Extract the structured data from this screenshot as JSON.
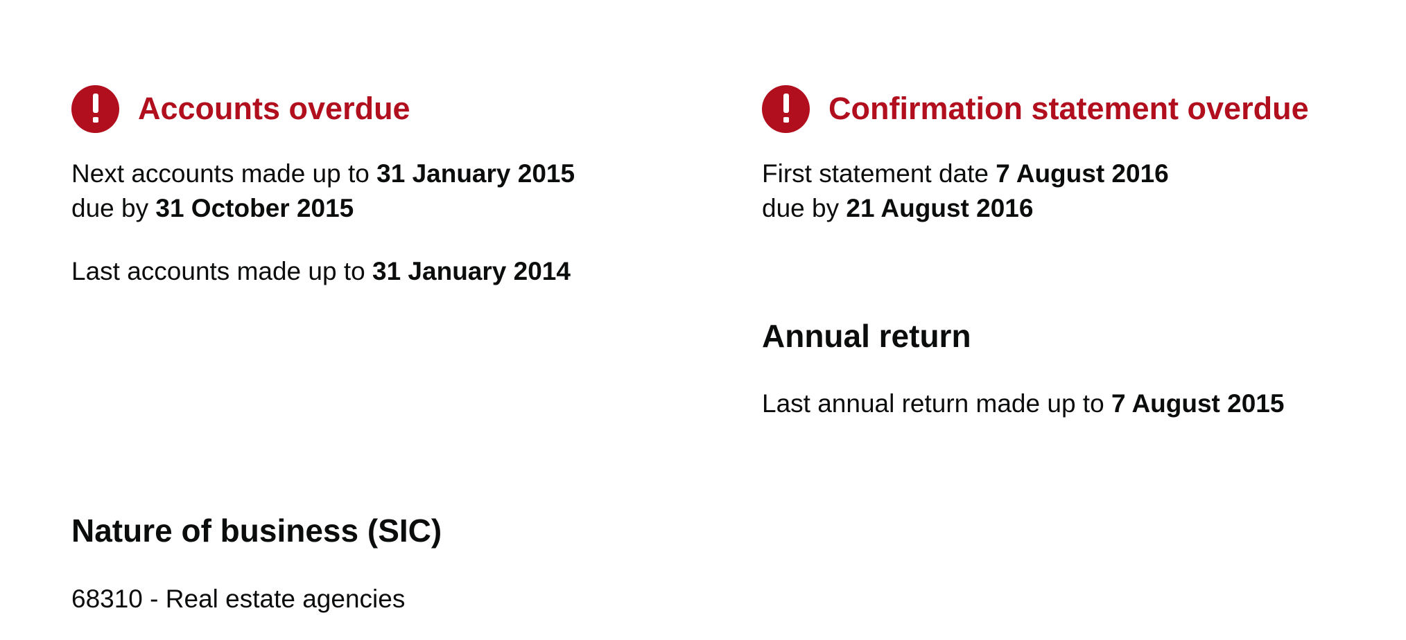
{
  "accounts": {
    "alert_title": "Accounts overdue",
    "alert_icon": "exclamation-icon",
    "alert_color": "#b10e1e",
    "next_label": "Next accounts made up to",
    "next_date": "31 January 2015",
    "due_label": "due by",
    "due_date": "31 October 2015",
    "last_label": "Last accounts made up to",
    "last_date": "31 January 2014"
  },
  "confirmation_statement": {
    "alert_title": "Confirmation statement overdue",
    "alert_icon": "exclamation-icon",
    "first_label": "First statement date",
    "first_date": "7 August 2016",
    "due_label": "due by",
    "due_date": "21 August 2016"
  },
  "annual_return": {
    "heading": "Annual return",
    "last_label": "Last annual return made up to",
    "last_date": "7 August 2015"
  },
  "nature_of_business": {
    "heading": "Nature of business (SIC)",
    "items": [
      "68310 - Real estate agencies"
    ]
  }
}
